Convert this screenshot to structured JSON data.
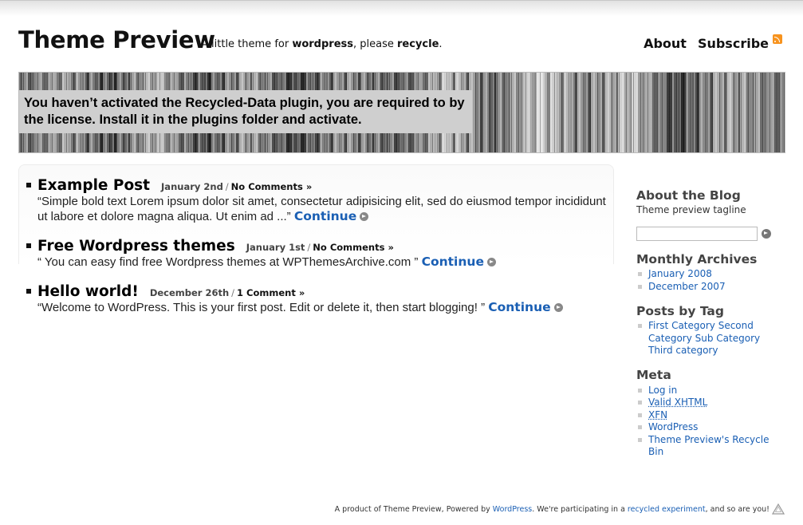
{
  "site": {
    "title": "Theme Preview",
    "tagline_1": "A little theme for ",
    "tagline_bold_1": "wordpress",
    "tagline_2": ", please ",
    "tagline_bold_2": "recycle",
    "tagline_3": "."
  },
  "nav": {
    "about": "About",
    "subscribe": "Subscribe"
  },
  "banner": {
    "notice": "You haven’t activated the Recycled-Data plugin, you are required to by the license. Install it in the plugins folder and activate."
  },
  "posts": [
    {
      "title": "Example Post",
      "date": "January 2nd",
      "separator": "/",
      "comments": "No Comments »",
      "excerpt": "“Simple bold text Lorem ipsum dolor sit amet, consectetur adipisicing elit, sed do eiusmod tempor incididunt ut labore et dolore magna aliqua. Ut enim ad ...”",
      "continue": "Continue"
    },
    {
      "title": "Free Wordpress themes",
      "date": "January 1st",
      "separator": "/",
      "comments": "No Comments »",
      "excerpt": "“ You can easy find free Wordpress themes at WPThemesArchive.com ”",
      "continue": "Continue"
    },
    {
      "title": "Hello world!",
      "date": "December 26th",
      "separator": "/",
      "comments": "1 Comment »",
      "excerpt": "“Welcome to WordPress. This is your first post. Edit or delete it, then start blogging! ”",
      "continue": "Continue"
    }
  ],
  "sidebar": {
    "about_heading": "About the Blog",
    "about_tagline": "Theme preview tagline",
    "archives_heading": "Monthly Archives",
    "archives": [
      "January 2008",
      "December 2007"
    ],
    "tags_heading": "Posts by Tag",
    "tags": [
      "First Category Second Category Sub Category Third category"
    ],
    "meta_heading": "Meta",
    "meta": [
      "Log in",
      "Valid XHTML",
      "XFN",
      "WordPress",
      "Theme Preview's Recycle Bin"
    ]
  },
  "footer": {
    "text_1": "A product of Theme Preview, Powered by ",
    "link_1": "WordPress",
    "text_2": ". We're participating in a ",
    "link_2": "recycled experiment",
    "text_3": ", and so are you!"
  },
  "colors": {
    "link": "#1a5fb4",
    "rss": "#f7931e",
    "notice_bg": "#cfcfcf"
  },
  "icons": {
    "subscribe": "rss-icon",
    "continue": "arrow-circle-icon",
    "search": "arrow-circle-icon",
    "footer": "recycle-icon"
  }
}
